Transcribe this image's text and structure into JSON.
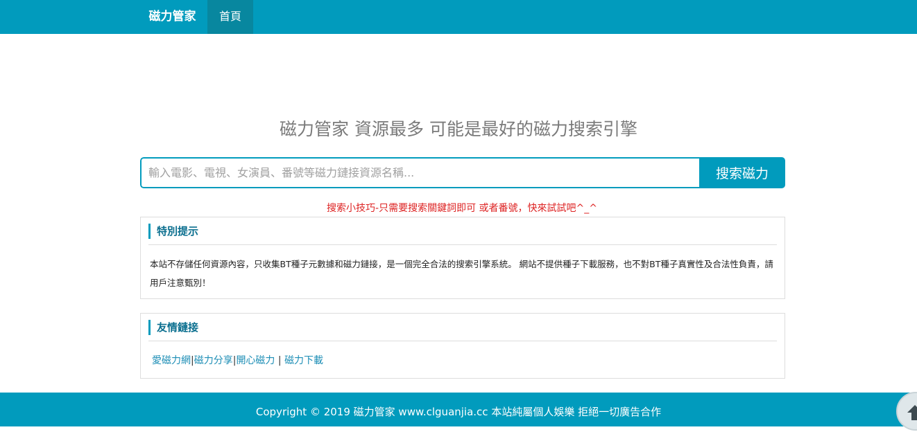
{
  "navbar": {
    "brand": "磁力管家",
    "home_label": "首頁"
  },
  "hero": {
    "headline": "磁力管家 資源最多 可能是最好的磁力搜索引擎"
  },
  "search": {
    "placeholder": "輸入電影、電視、女演員、番號等磁力鏈接資源名稱...",
    "button_label": "搜索磁力"
  },
  "tip": "搜索小技巧-只需要搜索關鍵詞即可 或者番號，快來試試吧^_^",
  "notice": {
    "title": "特別提示",
    "body": "本站不存儲任何資源內容，只收集BT種子元數據和磁力鏈接，是一個完全合法的搜索引擎系統。 網站不提供種子下載服務，也不對BT種子真實性及合法性負責，請用戶注意甄別！"
  },
  "links": {
    "title": "友情鏈接",
    "items": [
      "愛磁力網",
      "磁力分享",
      "開心磁力",
      "磁力下載"
    ],
    "separators": [
      "|",
      "|",
      "|"
    ]
  },
  "footer": {
    "copyright": "Copyright © 2019 磁力管家 www.clguanjia.cc 本站純屬個人娛樂 拒絕一切廣告合作"
  },
  "icons": {
    "back_to_top": "arrow-up-icon"
  },
  "colors": {
    "primary": "#019bbd",
    "nav_active": "#08879f",
    "tip": "#dd2222",
    "link": "#1b8db5"
  }
}
